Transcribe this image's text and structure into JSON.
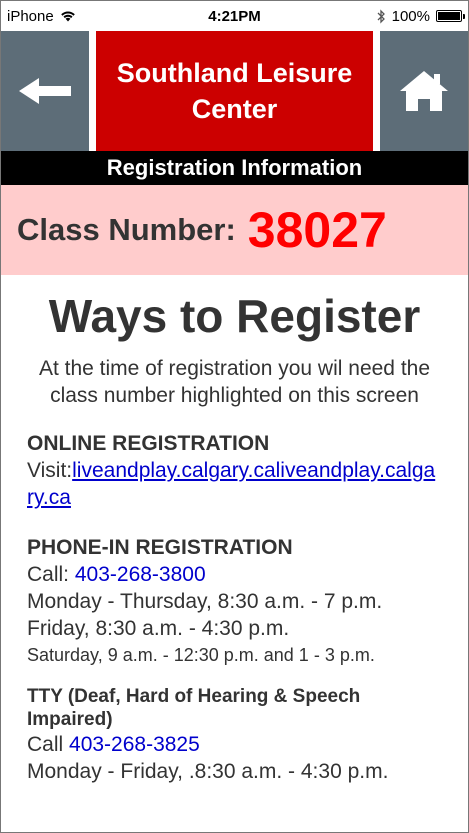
{
  "status_bar": {
    "carrier": "iPhone",
    "time": "4:21PM",
    "battery": "100%"
  },
  "header": {
    "title_line1": "Southland Leisure",
    "title_line2": "Center",
    "back_icon": "arrow-left-icon",
    "home_icon": "home-icon"
  },
  "registration_bar": "Registration Information",
  "class": {
    "label": "Class Number:",
    "number": "38027"
  },
  "main": {
    "heading": "Ways to Register",
    "intro": "At the time of registration you wil need the class number highlighted on this screen",
    "online": {
      "title": "ONLINE REGISTRATION",
      "visit_label": "Visit:",
      "link": "liveandplay.calgary.caliveandplay.calgary.ca"
    },
    "phone": {
      "title": "PHONE-IN REGISTRATION",
      "call_label": "Call: ",
      "number": "403-268-3800",
      "hours1": "Monday - Thursday, 8:30 a.m. - 7 p.m.",
      "hours2": "Friday, 8:30 a.m. - 4:30 p.m.",
      "hours3": "Saturday, 9 a.m. - 12:30 p.m. and 1 - 3 p.m."
    },
    "tty": {
      "title": "TTY (Deaf, Hard of Hearing & Speech Impaired)",
      "call_label": "Call ",
      "number": "403-268-3825",
      "hours": "Monday - Friday, .8:30 a.m. - 4:30 p.m."
    }
  }
}
